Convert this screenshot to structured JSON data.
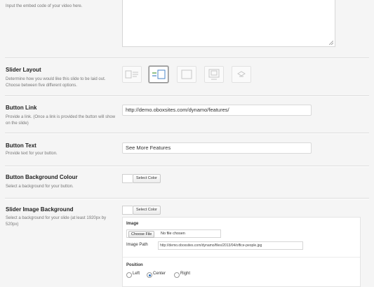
{
  "embed": {
    "description": "Input the embed code of your video here."
  },
  "slider_layout": {
    "title": "Slider Layout",
    "description": "Determine how you would like this slide to be laid out. Choose between five different options.",
    "selected": 2
  },
  "button_link": {
    "title": "Button Link",
    "description": "Provide a link. (Once a link is provided the button will show on the slide)",
    "value": "http://demo.oboxsites.com/dynamo/features/"
  },
  "button_text": {
    "title": "Button Text",
    "description": "Provide text for your button.",
    "value": "See More Features"
  },
  "button_bg": {
    "title": "Button Background Colour",
    "description": "Select a background for your button.",
    "select_label": "Select Color"
  },
  "slider_image_bg": {
    "title": "Slider Image Background",
    "description": "Select a background for your slide (at least 1920px by 520px)",
    "select_label": "Select Color",
    "image_heading": "Image",
    "choose_file_label": "Choose File",
    "no_file_label": "No file chosen",
    "image_path_label": "Image Path",
    "image_path_value": "http://demo.oboxsites.com/dynamo/files/2013/04/office-people.jpg",
    "position_heading": "Position",
    "position_options": [
      "Left",
      "Center",
      "Right"
    ],
    "position_selected": "Center"
  },
  "colors": {
    "background": "#f5f5f5",
    "radio_selected": "#2a6fbd"
  }
}
